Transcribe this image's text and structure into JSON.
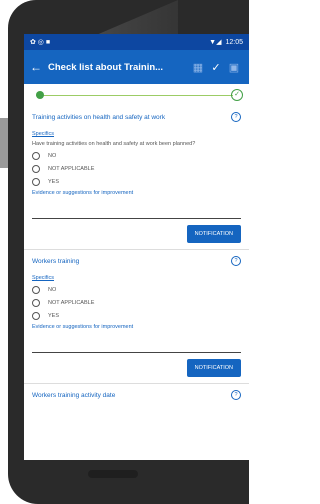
{
  "status": {
    "left_icons": "✿ ◎ ■",
    "right_icons": "▼◢",
    "time": "12:05"
  },
  "appbar": {
    "back_icon": "←",
    "title": "Check list about Trainin...",
    "icon1": "▦",
    "icon2": "✓",
    "icon3": "▣"
  },
  "progress": {
    "done_icon": "✓"
  },
  "sections": [
    {
      "title": "Training activities on health and safety at work",
      "help": "?",
      "specifics": "Specifics",
      "question": "Have training activities on health and safety at work been planned?",
      "options": [
        "NO",
        "NOT APPLICABLE",
        "YES"
      ],
      "evidence": "Evidence or suggestions for improvement",
      "notification": "NOTIFICATION"
    },
    {
      "title": "Workers training",
      "help": "?",
      "specifics": "Specifics",
      "options": [
        "NO",
        "NOT APPLICABLE",
        "YES"
      ],
      "evidence": "Evidence or suggestions for improvement",
      "notification": "NOTIFICATION"
    },
    {
      "title": "Workers training activity date",
      "help": "?"
    }
  ]
}
